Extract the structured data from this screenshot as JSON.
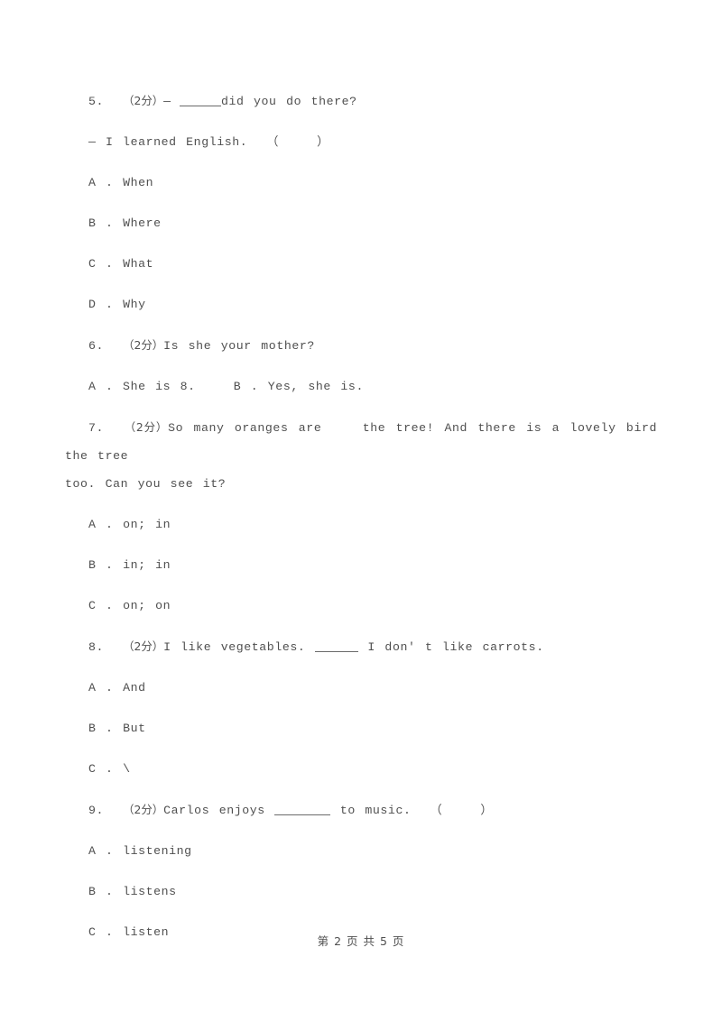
{
  "document": {
    "type": "exam-paper",
    "language": "zh-CN + en",
    "page_background": "#ffffff",
    "text_color": "#4f4f4f"
  },
  "footer": {
    "text": "第 2 页 共 5 页",
    "page_number": "2",
    "total_pages": "5"
  },
  "questions": [
    {
      "id": "q5",
      "number": "5.",
      "score": "（2分）",
      "stem_before": "— ",
      "blank": true,
      "stem_after": "did you do there?",
      "answer_line": "— I learned English.  （    ）",
      "options": [
        {
          "key": "A .",
          "text": "When"
        },
        {
          "key": "B .",
          "text": "Where"
        },
        {
          "key": "C .",
          "text": "What"
        },
        {
          "key": "D .",
          "text": "Why"
        }
      ]
    },
    {
      "id": "q6",
      "number": "6.",
      "score": "（2分）",
      "stem": "Is she your mother?",
      "options_inline": "A . She is 8.    B . Yes, she is.",
      "options": [
        {
          "key": "A .",
          "text": "She is 8."
        },
        {
          "key": "B .",
          "text": "Yes, she is."
        }
      ]
    },
    {
      "id": "q7",
      "number": "7.",
      "score": "（2分）",
      "stem_line1": "So many oranges are    the tree! And there is a lovely bird    the tree",
      "stem_line2": "too. Can you see it?",
      "options": [
        {
          "key": "A .",
          "text": "on; in"
        },
        {
          "key": "B .",
          "text": "in; in"
        },
        {
          "key": "C .",
          "text": "on; on"
        }
      ]
    },
    {
      "id": "q8",
      "number": "8.",
      "score": "（2分）",
      "stem_before": "I like vegetables. ",
      "blank": true,
      "stem_after": " I don' t like carrots.",
      "options": [
        {
          "key": "A .",
          "text": "And"
        },
        {
          "key": "B .",
          "text": "But"
        },
        {
          "key": "C .",
          "text": "\\"
        }
      ]
    },
    {
      "id": "q9",
      "number": "9.",
      "score": "（2分）",
      "stem_before": "Carlos enjoys ",
      "blank": true,
      "stem_after": " to music.  （    ）",
      "options": [
        {
          "key": "A .",
          "text": "listening"
        },
        {
          "key": "B .",
          "text": "listens"
        },
        {
          "key": "C .",
          "text": "listen"
        }
      ]
    }
  ]
}
